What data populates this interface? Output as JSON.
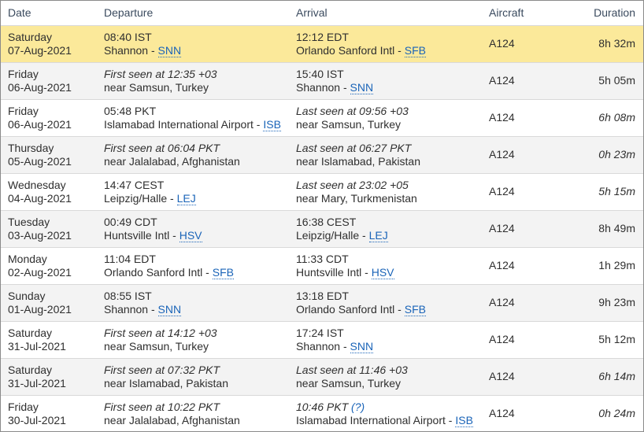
{
  "header": {
    "date": "Date",
    "departure": "Departure",
    "arrival": "Arrival",
    "aircraft": "Aircraft",
    "duration": "Duration"
  },
  "colors": {
    "selected_row": "#fbe99a",
    "odd_row": "#f3f3f3",
    "link": "#1a64b8"
  },
  "rows": [
    {
      "day": "Saturday",
      "date": "07-Aug-2021",
      "dep_line1": "08:40 IST",
      "dep_line1_italic": false,
      "dep_line2": "Shannon - ",
      "dep_code": "SNN",
      "arr_line1": "12:12 EDT",
      "arr_line1_italic": false,
      "arr_line2": "Orlando Sanford Intl - ",
      "arr_code": "SFB",
      "aircraft": "A124",
      "duration": "8h 32m",
      "duration_italic": false,
      "selected": true
    },
    {
      "day": "Friday",
      "date": "06-Aug-2021",
      "dep_line1": "First seen at 12:35 +03",
      "dep_line1_italic": true,
      "dep_line2": "near Samsun, Turkey",
      "dep_code": "",
      "arr_line1": "15:40 IST",
      "arr_line1_italic": false,
      "arr_line2": "Shannon - ",
      "arr_code": "SNN",
      "aircraft": "A124",
      "duration": "5h 05m",
      "duration_italic": false,
      "selected": false
    },
    {
      "day": "Friday",
      "date": "06-Aug-2021",
      "dep_line1": "05:48 PKT",
      "dep_line1_italic": false,
      "dep_line2": "Islamabad International Airport - ",
      "dep_code": "ISB",
      "arr_line1": "Last seen at 09:56 +03",
      "arr_line1_italic": true,
      "arr_line2": "near Samsun, Turkey",
      "arr_code": "",
      "aircraft": "A124",
      "duration": "6h 08m",
      "duration_italic": true,
      "selected": false
    },
    {
      "day": "Thursday",
      "date": "05-Aug-2021",
      "dep_line1": "First seen at 06:04 PKT",
      "dep_line1_italic": true,
      "dep_line2": "near Jalalabad, Afghanistan",
      "dep_code": "",
      "arr_line1": "Last seen at 06:27 PKT",
      "arr_line1_italic": true,
      "arr_line2": "near Islamabad, Pakistan",
      "arr_code": "",
      "aircraft": "A124",
      "duration": "0h 23m",
      "duration_italic": true,
      "selected": false
    },
    {
      "day": "Wednesday",
      "date": "04-Aug-2021",
      "dep_line1": "14:47 CEST",
      "dep_line1_italic": false,
      "dep_line2": "Leipzig/Halle - ",
      "dep_code": "LEJ",
      "arr_line1": "Last seen at 23:02 +05",
      "arr_line1_italic": true,
      "arr_line2": "near Mary, Turkmenistan",
      "arr_code": "",
      "aircraft": "A124",
      "duration": "5h 15m",
      "duration_italic": true,
      "selected": false
    },
    {
      "day": "Tuesday",
      "date": "03-Aug-2021",
      "dep_line1": "00:49 CDT",
      "dep_line1_italic": false,
      "dep_line2": "Huntsville Intl - ",
      "dep_code": "HSV",
      "arr_line1": "16:38 CEST",
      "arr_line1_italic": false,
      "arr_line2": "Leipzig/Halle - ",
      "arr_code": "LEJ",
      "aircraft": "A124",
      "duration": "8h 49m",
      "duration_italic": false,
      "selected": false
    },
    {
      "day": "Monday",
      "date": "02-Aug-2021",
      "dep_line1": "11:04 EDT",
      "dep_line1_italic": false,
      "dep_line2": "Orlando Sanford Intl - ",
      "dep_code": "SFB",
      "arr_line1": "11:33 CDT",
      "arr_line1_italic": false,
      "arr_line2": "Huntsville Intl - ",
      "arr_code": "HSV",
      "aircraft": "A124",
      "duration": "1h 29m",
      "duration_italic": false,
      "selected": false
    },
    {
      "day": "Sunday",
      "date": "01-Aug-2021",
      "dep_line1": "08:55 IST",
      "dep_line1_italic": false,
      "dep_line2": "Shannon - ",
      "dep_code": "SNN",
      "arr_line1": "13:18 EDT",
      "arr_line1_italic": false,
      "arr_line2": "Orlando Sanford Intl - ",
      "arr_code": "SFB",
      "aircraft": "A124",
      "duration": "9h 23m",
      "duration_italic": false,
      "selected": false
    },
    {
      "day": "Saturday",
      "date": "31-Jul-2021",
      "dep_line1": "First seen at 14:12 +03",
      "dep_line1_italic": true,
      "dep_line2": "near Samsun, Turkey",
      "dep_code": "",
      "arr_line1": "17:24 IST",
      "arr_line1_italic": false,
      "arr_line2": "Shannon - ",
      "arr_code": "SNN",
      "aircraft": "A124",
      "duration": "5h 12m",
      "duration_italic": false,
      "selected": false
    },
    {
      "day": "Saturday",
      "date": "31-Jul-2021",
      "dep_line1": "First seen at 07:32 PKT",
      "dep_line1_italic": true,
      "dep_line2": "near Islamabad, Pakistan",
      "dep_code": "",
      "arr_line1": "Last seen at 11:46 +03",
      "arr_line1_italic": true,
      "arr_line2": "near Samsun, Turkey",
      "arr_code": "",
      "aircraft": "A124",
      "duration": "6h 14m",
      "duration_italic": true,
      "selected": false
    },
    {
      "day": "Friday",
      "date": "30-Jul-2021",
      "dep_line1": "First seen at 10:22 PKT",
      "dep_line1_italic": true,
      "dep_line2": "near Jalalabad, Afghanistan",
      "dep_code": "",
      "arr_line1": "10:46 PKT",
      "arr_line1_italic": true,
      "arr_line1_link": "(?)",
      "arr_line2": "Islamabad International Airport - ",
      "arr_code": "ISB",
      "aircraft": "A124",
      "duration": "0h 24m",
      "duration_italic": true,
      "selected": false
    }
  ]
}
